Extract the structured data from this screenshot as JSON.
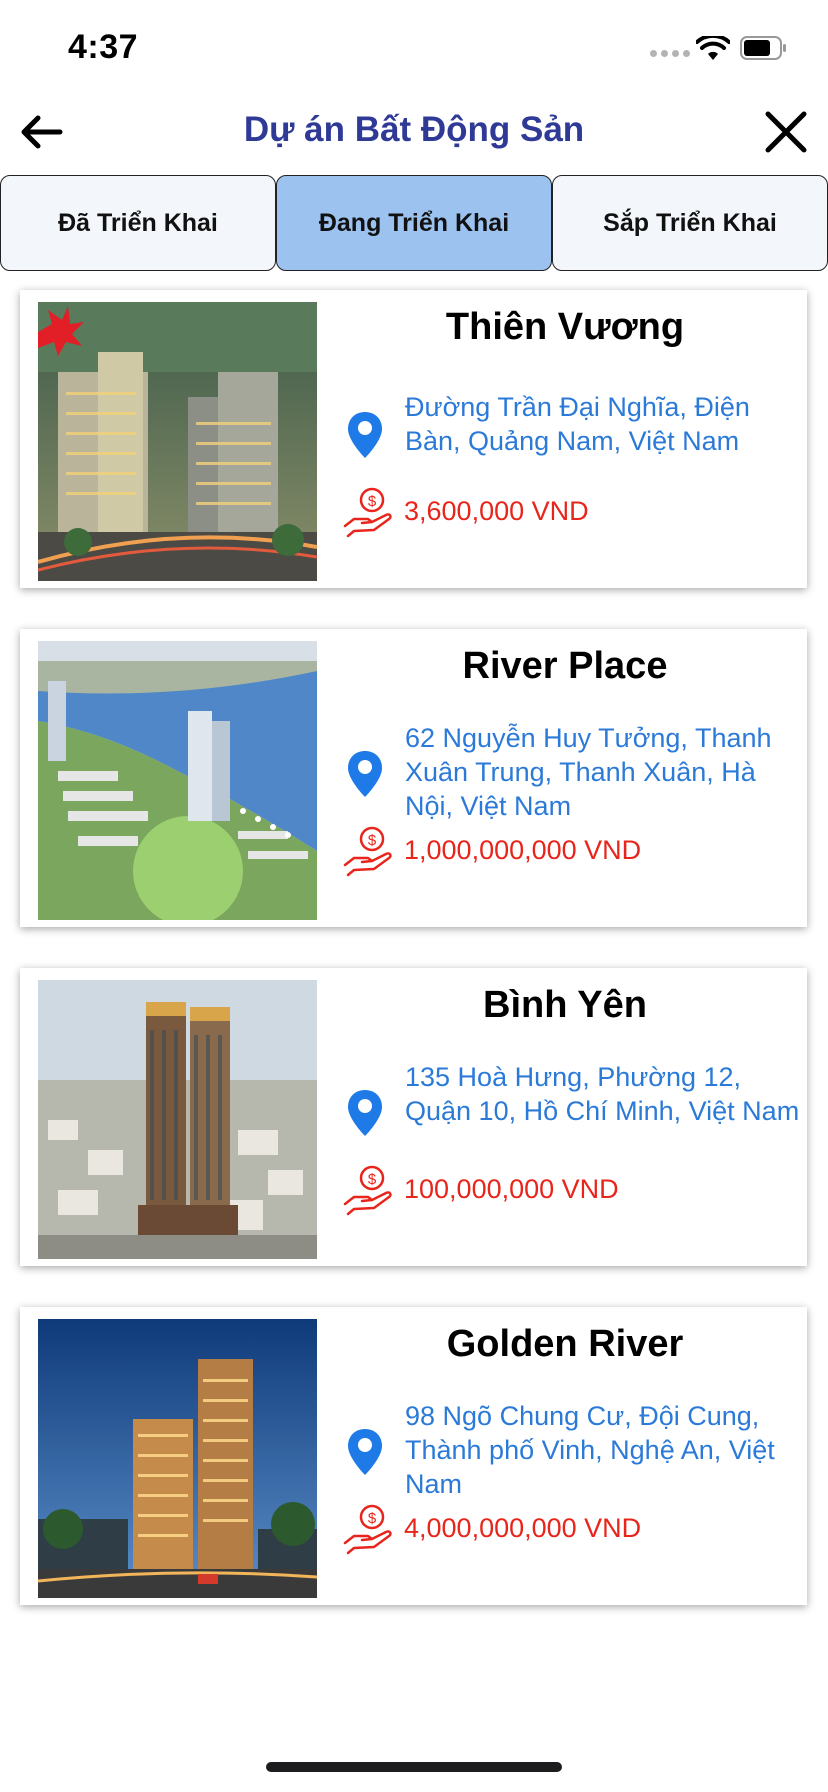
{
  "status_bar": {
    "time": "4:37"
  },
  "header": {
    "title": "Dự án Bất Động Sản"
  },
  "tabs": [
    {
      "label": "Đã Triển Khai",
      "active": false
    },
    {
      "label": "Đang Triển Khai",
      "active": true
    },
    {
      "label": "Sắp Triển Khai",
      "active": false
    }
  ],
  "projects": [
    {
      "name": "Thiên Vương",
      "address": "Đường Trần Đại Nghĩa, Điện Bàn, Quảng Nam, Việt Nam",
      "price": "3,600,000 VND"
    },
    {
      "name": "River Place",
      "address": "62 Nguyễn Huy Tưởng, Thanh Xuân Trung, Thanh Xuân, Hà Nội, Việt Nam",
      "price": "1,000,000,000 VND"
    },
    {
      "name": "Bình Yên",
      "address": "135 Hoà Hưng, Phường 12, Quận 10, Hồ Chí Minh, Việt Nam",
      "price": "100,000,000 VND"
    },
    {
      "name": "Golden River",
      "address": "98 Ngõ Chung Cư, Đội Cung, Thành phố Vinh, Nghệ An, Việt Nam",
      "price": "4,000,000,000 VND"
    }
  ],
  "colors": {
    "title": "#2f3a97",
    "active_tab": "#9cc2f0",
    "address": "#2b7ad8",
    "price": "#e8251b",
    "pin": "#1e7ae6"
  }
}
